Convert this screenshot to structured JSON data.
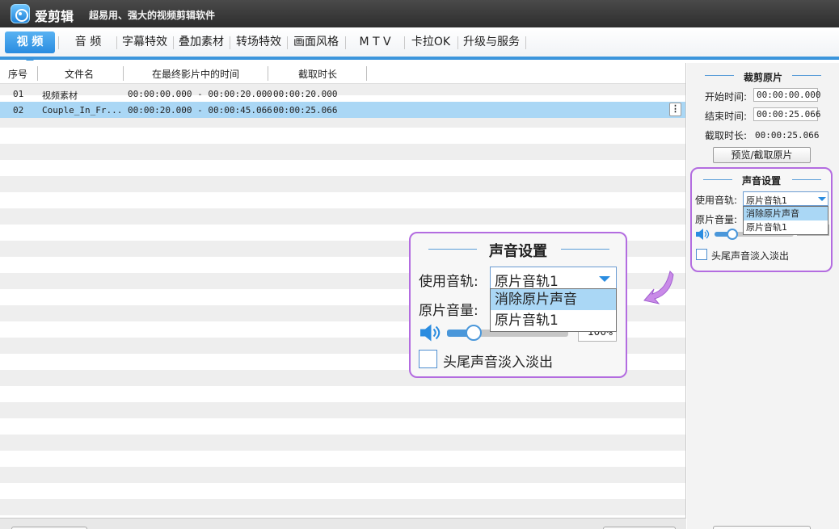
{
  "app": {
    "name": "爱剪辑",
    "slogan": "超易用、强大的视频剪辑软件"
  },
  "tabs": [
    {
      "label": "视 频",
      "active": true
    },
    {
      "label": "音 频"
    },
    {
      "label": "字幕特效"
    },
    {
      "label": "叠加素材"
    },
    {
      "label": "转场特效"
    },
    {
      "label": "画面风格"
    },
    {
      "label": "M T V"
    },
    {
      "label": "卡拉OK"
    },
    {
      "label": "升级与服务"
    }
  ],
  "file_list": {
    "columns": [
      "序号",
      "文件名",
      "在最终影片中的时间",
      "截取时长"
    ],
    "rows": [
      {
        "index": "01",
        "name": "视频素材",
        "time_range": "00:00:00.000 - 00:00:20.000",
        "duration": "00:00:20.000",
        "selected": false
      },
      {
        "index": "02",
        "name": "Couple_In_Fr...",
        "time_range": "00:00:20.000 - 00:00:45.066",
        "duration": "00:00:25.066",
        "selected": true
      }
    ],
    "row_menu_glyph": "⋮"
  },
  "crop": {
    "title": "裁剪原片",
    "start_label": "开始时间:",
    "start_value": "00:00:00.000",
    "end_label": "结束时间:",
    "end_value": "00:00:25.066",
    "duration_label": "截取时长:",
    "duration_value": "00:00:25.066",
    "preview_button": "预览/截取原片"
  },
  "audio": {
    "title": "声音设置",
    "track_label": "使用音轨:",
    "track_selected": "原片音轨1",
    "track_options": [
      "消除原片声音",
      "原片音轨1"
    ],
    "highlighted_option": "消除原片声音",
    "volume_label": "原片音量:",
    "volume_percent": 100,
    "volume_text": "100%",
    "fade_label": "头尾声音淡入淡出",
    "fade_checked": false
  },
  "colors": {
    "accent": "#3b95dc",
    "selection": "#aad7f5",
    "highlight_border": "#b36ce0",
    "arrow": "#c98ae8"
  },
  "icons": {
    "logo": "app-logo-icon",
    "speaker": "speaker-icon",
    "dropdown": "chevron-down-icon",
    "arrow": "pointing-arrow-icon"
  }
}
